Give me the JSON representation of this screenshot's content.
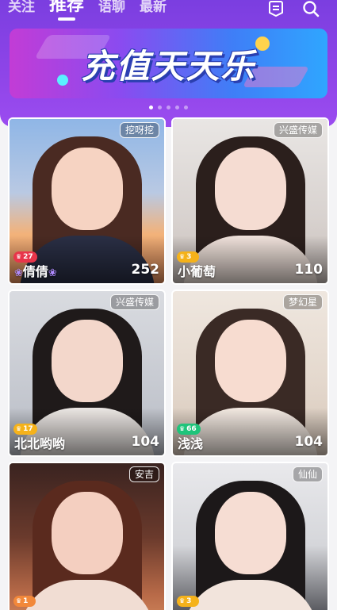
{
  "tabs": [
    {
      "label": "关注",
      "active": false
    },
    {
      "label": "推荐",
      "active": true
    },
    {
      "label": "语聊",
      "active": false
    },
    {
      "label": "最新",
      "active": false
    }
  ],
  "header_icons": [
    "message-icon",
    "search-icon"
  ],
  "banner": {
    "text": "充值天天乐"
  },
  "carousel": {
    "count": 5,
    "active_index": 0
  },
  "cards": [
    {
      "tag": "挖呀挖",
      "level": "27",
      "badge_color": "#e8354a",
      "name": "倩倩",
      "name_deco": "❀",
      "count": "252"
    },
    {
      "tag": "兴盛传媒",
      "level": "3",
      "badge_color": "#f5b21a",
      "name": "小葡萄",
      "name_deco": "",
      "count": "110"
    },
    {
      "tag": "兴盛传媒",
      "level": "17",
      "badge_color": "#f5b21a",
      "name": "北北哟哟",
      "name_deco": "",
      "count": "104"
    },
    {
      "tag": "梦幻星",
      "level": "66",
      "badge_color": "#1ec47a",
      "name": "浅浅",
      "name_deco": "",
      "count": "104"
    },
    {
      "tag": "安吉",
      "level": "1",
      "badge_color": "#f2883a",
      "name": "",
      "name_deco": "",
      "count": ""
    },
    {
      "tag": "仙仙",
      "level": "3",
      "badge_color": "#f5b21a",
      "name": "",
      "name_deco": "",
      "count": ""
    }
  ]
}
